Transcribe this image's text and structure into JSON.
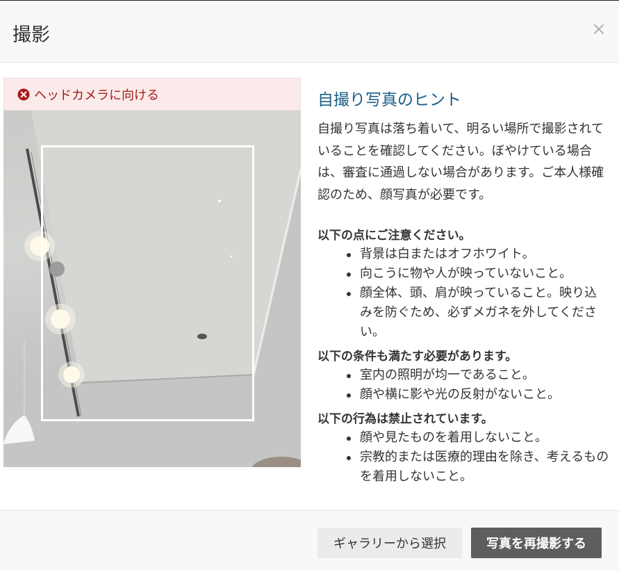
{
  "modal": {
    "title": "撮影",
    "close_symbol": "×"
  },
  "alert": {
    "icon": "close-circle-icon",
    "text": "ヘッドカメラに向ける",
    "color": "#a61b1b"
  },
  "tips": {
    "title": "自撮り写真のヒント",
    "intro": "自撮り写真は落ち着いて、明るい場所で撮影されていることを確認してください。ぼやけている場合は、審査に通過しない場合があります。ご本人様確認のため、顔写真が必要です。",
    "sections": [
      {
        "heading": "以下の点にご注意ください。",
        "items": [
          "背景は白またはオフホワイト。",
          "向こうに物や人が映っていないこと。",
          "顔全体、頭、肩が映っていること。映り込みを防ぐため、必ずメガネを外してください。"
        ]
      },
      {
        "heading": "以下の条件も満たす必要があります。",
        "items": [
          "室内の照明が均一であること。",
          "顔や横に影や光の反射がないこと。"
        ]
      },
      {
        "heading": "以下の行為は禁止されています。",
        "items": [
          "顔や見たものを着用しないこと。",
          "宗教的または医療的理由を除き、考えるものを着用しないこと。"
        ]
      }
    ]
  },
  "footer": {
    "gallery_label": "ギャラリーから選択",
    "retake_label": "写真を再撮影する"
  },
  "colors": {
    "title_accent": "#1b5e86",
    "primary_button": "#5e5e5e",
    "alert_background": "#fbeaea"
  }
}
